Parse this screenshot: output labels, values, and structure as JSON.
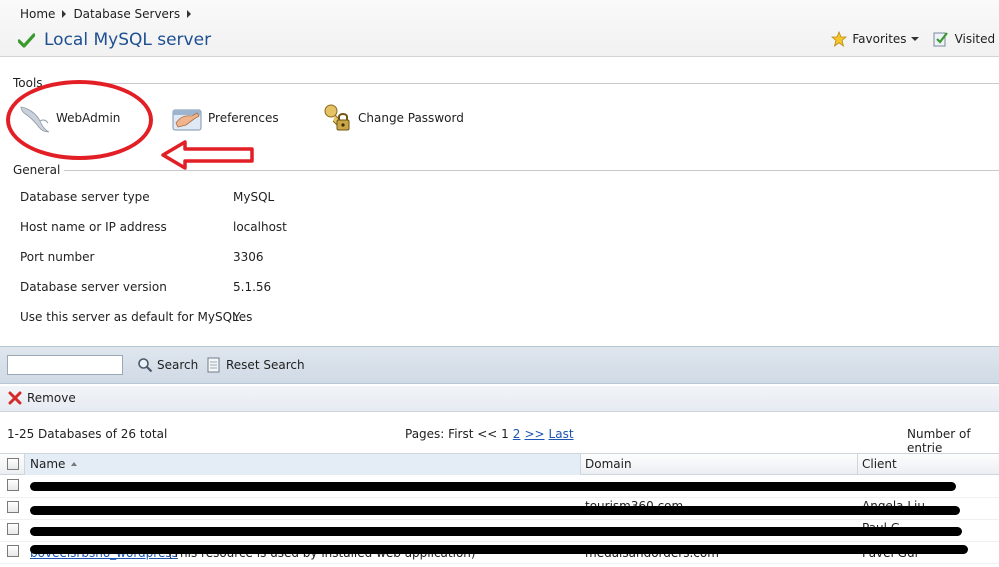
{
  "breadcrumb": {
    "home": "Home",
    "section": "Database Servers"
  },
  "title": "Local MySQL server",
  "top_links": {
    "favorites": "Favorites",
    "visited": "Visited Pa"
  },
  "tools": {
    "label": "Tools",
    "items": [
      {
        "label": "WebAdmin",
        "icon": "mysql-dolphin-icon"
      },
      {
        "label": "Preferences",
        "icon": "preferences-hand-icon"
      },
      {
        "label": "Change Password",
        "icon": "keys-lock-icon"
      }
    ]
  },
  "general": {
    "label": "General",
    "rows": [
      {
        "label": "Database server type",
        "value": "MySQL"
      },
      {
        "label": "Host name or IP address",
        "value": "localhost"
      },
      {
        "label": "Port number",
        "value": "3306"
      },
      {
        "label": "Database server version",
        "value": "5.1.56"
      },
      {
        "label": "Use this server as default for MySQL",
        "value": "Yes"
      }
    ]
  },
  "search": {
    "value": "",
    "search_label": "Search",
    "reset_label": "Reset Search"
  },
  "actions": {
    "remove_label": "Remove"
  },
  "summary": {
    "total": "1-25 Databases of 26 total",
    "pages_prefix": "Pages: First << 1",
    "page2": "2",
    "next": ">>",
    "last": "Last",
    "entries": "Number of entrie"
  },
  "table": {
    "columns": {
      "name": "Name",
      "domain": "Domain",
      "client": "Client"
    },
    "rows": [
      {
        "name": "",
        "note": "",
        "domain": "",
        "client": ""
      },
      {
        "name": "",
        "note": "",
        "domain": "tourism360.com",
        "client": "Angela Liu"
      },
      {
        "name": "",
        "note": "",
        "domain": "",
        "client": "Paul G"
      },
      {
        "name": "boveelsrbsho_wordpress",
        "note": "(This resource is used by installed web application)",
        "domain": "medalsandorders.com",
        "client": "Pavel Gur"
      }
    ]
  },
  "colors": {
    "accent": "#1d4f91",
    "link": "#1a55b0",
    "annotation": "#e31f26",
    "remove": "#d62a2a"
  }
}
